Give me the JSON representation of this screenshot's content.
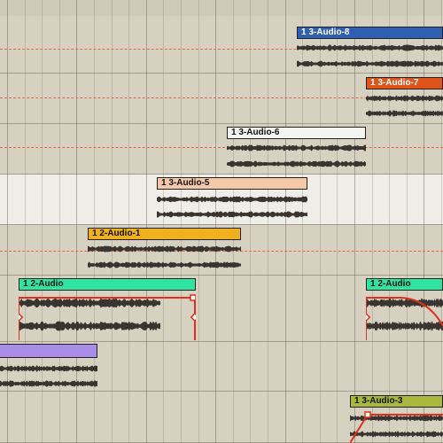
{
  "app": {
    "view": "arrangement"
  },
  "clips": {
    "c8": {
      "label": "1 3-Audio-8",
      "color": "#2f5fb0",
      "text_color": "#ffffff"
    },
    "c7": {
      "label": "1 3-Audio-7",
      "color": "#e0531a",
      "text_color": "#ffffff"
    },
    "c6": {
      "label": "1 3-Audio-6",
      "color": "#f4f4f0",
      "text_color": "#111111"
    },
    "c5": {
      "label": "1 3-Audio-5",
      "color": "#f5c9a8",
      "text_color": "#111111"
    },
    "c1": {
      "label": "1 2-Audio-1",
      "color": "#f0b020",
      "text_color": "#111111"
    },
    "c2a": {
      "label": "1 2-Audio",
      "color": "#2fe3a0",
      "text_color": "#111111"
    },
    "c2b": {
      "label": "1 2-Audio",
      "color": "#2fe3a0",
      "text_color": "#111111"
    },
    "cpurple": {
      "label": "",
      "color": "#a98be8",
      "text_color": "#111111"
    },
    "c3": {
      "label": "1 3-Audio-3",
      "color": "#a9b83a",
      "text_color": "#111111"
    }
  },
  "colors": {
    "selected_lane": "#efede7",
    "envelope": "#e0301a",
    "waveform": "#3a3530"
  }
}
